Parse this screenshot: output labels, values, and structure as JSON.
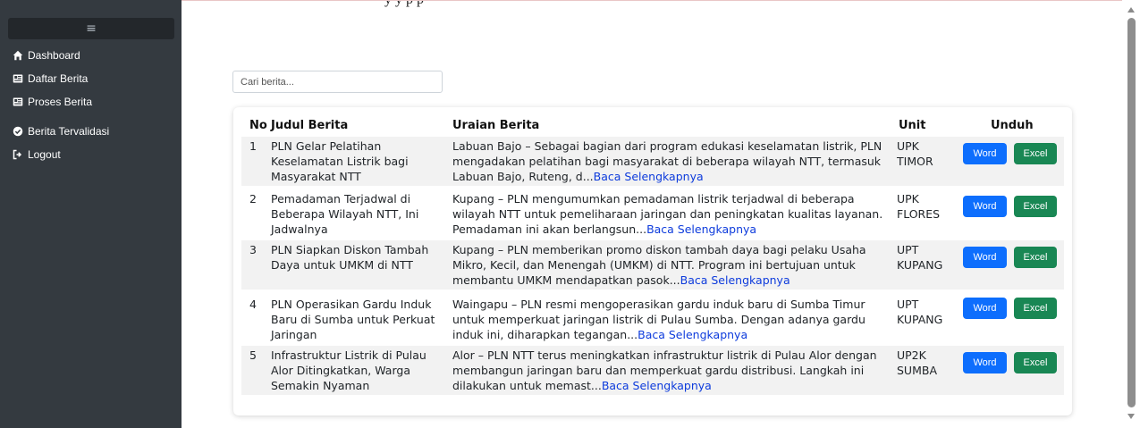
{
  "top_fragment": "y     y          p        p",
  "sidebar": {
    "hamburger": "≡",
    "items": [
      {
        "label": "Dashboard",
        "icon": "home-icon"
      },
      {
        "label": "Daftar Berita",
        "icon": "newspaper-icon"
      },
      {
        "label": "Proses Berita",
        "icon": "newspaper-icon"
      },
      {
        "label": "Berita Tervalidasi",
        "icon": "check-circle-icon"
      },
      {
        "label": "Logout",
        "icon": "logout-icon"
      }
    ]
  },
  "search": {
    "placeholder": "Cari berita..."
  },
  "table": {
    "headers": {
      "no": "No",
      "title": "Judul Berita",
      "desc": "Uraian Berita",
      "unit": "Unit",
      "download": "Unduh"
    },
    "word_label": "Word",
    "excel_label": "Excel",
    "read_more": "Baca Selengkapnya",
    "rows": [
      {
        "no": "1",
        "title": "PLN Gelar Pelatihan Keselamatan Listrik bagi Masyarakat NTT",
        "desc": "Labuan Bajo – Sebagai bagian dari program edukasi keselamatan listrik, PLN mengadakan pelatihan bagi masyarakat di beberapa wilayah NTT, termasuk Labuan Bajo, Ruteng, d...",
        "unit": "UPK TIMOR"
      },
      {
        "no": "2",
        "title": "Pemadaman Terjadwal di Beberapa Wilayah NTT, Ini Jadwalnya",
        "desc": "Kupang – PLN mengumumkan pemadaman listrik terjadwal di beberapa wilayah NTT untuk pemeliharaan jaringan dan peningkatan kualitas layanan. Pemadaman ini akan berlangsun...",
        "unit": "UPK FLORES"
      },
      {
        "no": "3",
        "title": "PLN Siapkan Diskon Tambah Daya untuk UMKM di NTT",
        "desc": "Kupang – PLN memberikan promo diskon tambah daya bagi pelaku Usaha Mikro, Kecil, dan Menengah (UMKM) di NTT. Program ini bertujuan untuk membantu UMKM mendapatkan pasok...",
        "unit": "UPT KUPANG"
      },
      {
        "no": "4",
        "title": "PLN Operasikan Gardu Induk Baru di Sumba untuk Perkuat Jaringan",
        "desc": "Waingapu – PLN resmi mengoperasikan gardu induk baru di Sumba Timur untuk memperkuat jaringan listrik di Pulau Sumba. Dengan adanya gardu induk ini, diharapkan tegangan...",
        "unit": "UPT KUPANG"
      },
      {
        "no": "5",
        "title": "Infrastruktur Listrik di Pulau Alor Ditingkatkan, Warga Semakin Nyaman",
        "desc": "Alor – PLN NTT terus meningkatkan infrastruktur listrik di Pulau Alor dengan membangun jaringan baru dan memperkuat gardu distribusi. Langkah ini dilakukan untuk memast...",
        "unit": "UP2K SUMBA"
      }
    ]
  }
}
